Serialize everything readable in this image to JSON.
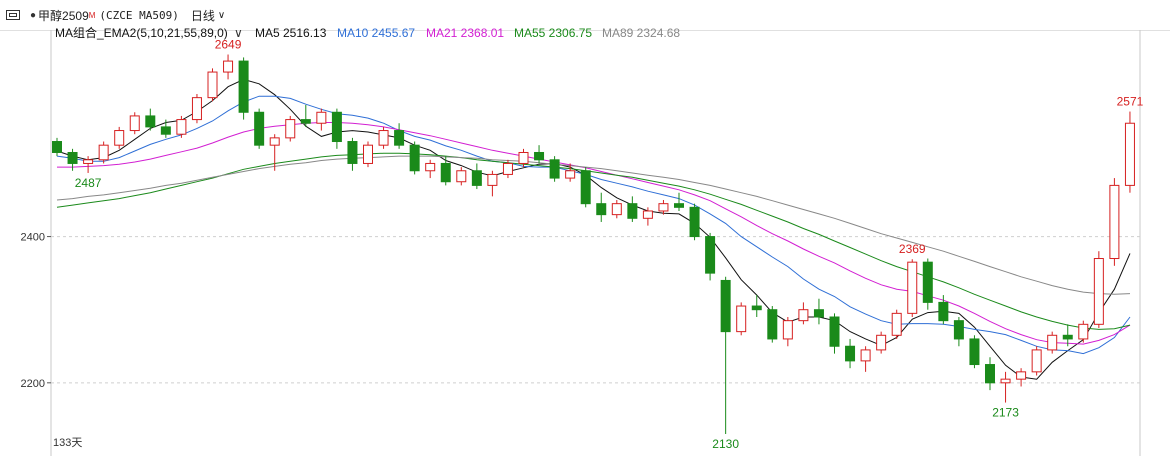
{
  "toolbar": {
    "symbol": "甲醇2509",
    "symbol_sup": "M",
    "code": "(CZCE MA509)",
    "period": "日线"
  },
  "legend": {
    "group": "MA组合_EMA2(5,10,21,55,89,0)",
    "items": [
      {
        "label": "MA5 2516.13",
        "color": "#111111"
      },
      {
        "label": "MA10 2455.67",
        "color": "#2f6fd6"
      },
      {
        "label": "MA21 2368.01",
        "color": "#d21fd2"
      },
      {
        "label": "MA55 2306.75",
        "color": "#1b8a1b"
      },
      {
        "label": "MA89 2324.68",
        "color": "#888888"
      }
    ]
  },
  "days_label": "133天",
  "colors": {
    "up": "#d62020",
    "down": "#1a8a1a",
    "grid": "#cfcfcf"
  },
  "chart_data": {
    "type": "candlestick",
    "ylim": [
      2130,
      2662
    ],
    "yticks": [
      2200,
      2400
    ],
    "annotations": [
      {
        "index": 11,
        "value": 2649,
        "label": "2649",
        "pos": "above",
        "color": "#d62020"
      },
      {
        "index": 2,
        "value": 2487,
        "label": "2487",
        "pos": "below",
        "color": "#1a8a1a"
      },
      {
        "index": 43,
        "value": 2130,
        "label": "2130",
        "pos": "below",
        "color": "#1a8a1a"
      },
      {
        "index": 55,
        "value": 2369,
        "label": "2369",
        "pos": "above",
        "color": "#d62020"
      },
      {
        "index": 61,
        "value": 2173,
        "label": "2173",
        "pos": "below",
        "color": "#1a8a1a"
      },
      {
        "index": 69,
        "value": 2571,
        "label": "2571",
        "pos": "above",
        "color": "#d62020"
      }
    ],
    "candles": [
      [
        2530,
        2535,
        2510,
        2515
      ],
      [
        2515,
        2520,
        2490,
        2500
      ],
      [
        2500,
        2510,
        2487,
        2505
      ],
      [
        2505,
        2530,
        2500,
        2525
      ],
      [
        2525,
        2550,
        2520,
        2545
      ],
      [
        2545,
        2570,
        2540,
        2565
      ],
      [
        2565,
        2575,
        2545,
        2550
      ],
      [
        2550,
        2560,
        2535,
        2540
      ],
      [
        2540,
        2565,
        2535,
        2560
      ],
      [
        2560,
        2595,
        2555,
        2590
      ],
      [
        2590,
        2630,
        2585,
        2625
      ],
      [
        2625,
        2649,
        2615,
        2640
      ],
      [
        2640,
        2645,
        2560,
        2570
      ],
      [
        2570,
        2575,
        2520,
        2525
      ],
      [
        2525,
        2540,
        2490,
        2535
      ],
      [
        2535,
        2565,
        2530,
        2560
      ],
      [
        2560,
        2580,
        2550,
        2555
      ],
      [
        2555,
        2575,
        2545,
        2570
      ],
      [
        2570,
        2575,
        2520,
        2530
      ],
      [
        2530,
        2535,
        2490,
        2500
      ],
      [
        2500,
        2530,
        2495,
        2525
      ],
      [
        2525,
        2550,
        2520,
        2545
      ],
      [
        2545,
        2555,
        2520,
        2525
      ],
      [
        2525,
        2530,
        2485,
        2490
      ],
      [
        2490,
        2505,
        2480,
        2500
      ],
      [
        2500,
        2510,
        2470,
        2475
      ],
      [
        2475,
        2495,
        2470,
        2490
      ],
      [
        2490,
        2500,
        2465,
        2470
      ],
      [
        2470,
        2490,
        2455,
        2485
      ],
      [
        2485,
        2505,
        2480,
        2500
      ],
      [
        2500,
        2520,
        2495,
        2515
      ],
      [
        2515,
        2525,
        2500,
        2505
      ],
      [
        2505,
        2510,
        2475,
        2480
      ],
      [
        2480,
        2500,
        2475,
        2490
      ],
      [
        2490,
        2495,
        2440,
        2445
      ],
      [
        2445,
        2460,
        2420,
        2430
      ],
      [
        2430,
        2450,
        2425,
        2445
      ],
      [
        2445,
        2455,
        2420,
        2425
      ],
      [
        2425,
        2440,
        2415,
        2435
      ],
      [
        2435,
        2450,
        2430,
        2445
      ],
      [
        2445,
        2460,
        2435,
        2440
      ],
      [
        2440,
        2445,
        2395,
        2400
      ],
      [
        2400,
        2405,
        2340,
        2350
      ],
      [
        2340,
        2345,
        2130,
        2270
      ],
      [
        2270,
        2310,
        2265,
        2305
      ],
      [
        2305,
        2320,
        2290,
        2300
      ],
      [
        2300,
        2305,
        2255,
        2260
      ],
      [
        2260,
        2290,
        2250,
        2285
      ],
      [
        2285,
        2310,
        2280,
        2300
      ],
      [
        2300,
        2315,
        2280,
        2290
      ],
      [
        2290,
        2295,
        2240,
        2250
      ],
      [
        2250,
        2260,
        2220,
        2230
      ],
      [
        2230,
        2250,
        2215,
        2245
      ],
      [
        2245,
        2270,
        2240,
        2265
      ],
      [
        2265,
        2300,
        2260,
        2295
      ],
      [
        2295,
        2369,
        2290,
        2365
      ],
      [
        2365,
        2370,
        2300,
        2310
      ],
      [
        2310,
        2320,
        2280,
        2285
      ],
      [
        2285,
        2290,
        2250,
        2260
      ],
      [
        2260,
        2265,
        2220,
        2225
      ],
      [
        2225,
        2235,
        2190,
        2200
      ],
      [
        2200,
        2215,
        2173,
        2205
      ],
      [
        2205,
        2220,
        2195,
        2215
      ],
      [
        2215,
        2250,
        2210,
        2245
      ],
      [
        2245,
        2270,
        2240,
        2265
      ],
      [
        2265,
        2280,
        2250,
        2260
      ],
      [
        2260,
        2285,
        2255,
        2280
      ],
      [
        2280,
        2380,
        2275,
        2370
      ],
      [
        2370,
        2480,
        2360,
        2470
      ],
      [
        2470,
        2571,
        2460,
        2555
      ]
    ],
    "ma": {
      "MA5": [
        2517,
        2510,
        2505,
        2508,
        2518,
        2533,
        2548,
        2556,
        2559,
        2571,
        2586,
        2605,
        2615,
        2609,
        2594,
        2574,
        2551,
        2537,
        2543,
        2545,
        2543,
        2539,
        2535,
        2525,
        2518,
        2504,
        2497,
        2488,
        2483,
        2489,
        2494,
        2499,
        2500,
        2495,
        2484,
        2467,
        2453,
        2443,
        2435,
        2432,
        2431,
        2418,
        2399,
        2371,
        2341,
        2320,
        2296,
        2283,
        2290,
        2290,
        2285,
        2270,
        2260,
        2251,
        2262,
        2287,
        2296,
        2298,
        2295,
        2276,
        2250,
        2224,
        2208,
        2205,
        2228,
        2244,
        2259,
        2296,
        2328,
        2377
      ],
      "MA10": [
        2510,
        2507,
        2503,
        2503,
        2508,
        2517,
        2526,
        2533,
        2539,
        2548,
        2558,
        2572,
        2584,
        2592,
        2592,
        2589,
        2581,
        2574,
        2568,
        2566,
        2562,
        2555,
        2545,
        2537,
        2532,
        2524,
        2518,
        2510,
        2503,
        2501,
        2496,
        2495,
        2495,
        2490,
        2485,
        2478,
        2473,
        2468,
        2462,
        2457,
        2452,
        2443,
        2431,
        2418,
        2400,
        2386,
        2372,
        2359,
        2342,
        2328,
        2318,
        2304,
        2294,
        2285,
        2280,
        2281,
        2281,
        2280,
        2277,
        2273,
        2270,
        2266,
        2258,
        2250,
        2245,
        2244,
        2240,
        2248,
        2262,
        2290
      ],
      "MA21": [
        2495,
        2495,
        2496,
        2497,
        2499,
        2502,
        2506,
        2511,
        2516,
        2521,
        2528,
        2536,
        2543,
        2548,
        2551,
        2553,
        2555,
        2556,
        2556,
        2555,
        2553,
        2550,
        2546,
        2542,
        2538,
        2533,
        2528,
        2523,
        2518,
        2514,
        2510,
        2506,
        2502,
        2498,
        2494,
        2489,
        2484,
        2479,
        2474,
        2469,
        2464,
        2457,
        2449,
        2438,
        2427,
        2415,
        2404,
        2394,
        2383,
        2373,
        2364,
        2353,
        2343,
        2334,
        2328,
        2325,
        2319,
        2313,
        2305,
        2295,
        2284,
        2274,
        2266,
        2259,
        2255,
        2254,
        2253,
        2258,
        2266,
        2279
      ],
      "MA55": [
        2440,
        2443,
        2446,
        2449,
        2452,
        2456,
        2460,
        2465,
        2470,
        2475,
        2480,
        2486,
        2492,
        2496,
        2500,
        2503,
        2506,
        2509,
        2511,
        2512,
        2513,
        2514,
        2514,
        2513,
        2512,
        2510,
        2508,
        2505,
        2503,
        2501,
        2499,
        2497,
        2495,
        2493,
        2490,
        2487,
        2484,
        2481,
        2477,
        2473,
        2469,
        2464,
        2458,
        2451,
        2444,
        2436,
        2428,
        2420,
        2411,
        2403,
        2394,
        2385,
        2376,
        2367,
        2359,
        2352,
        2345,
        2338,
        2330,
        2321,
        2313,
        2305,
        2297,
        2290,
        2284,
        2279,
        2275,
        2273,
        2274,
        2279
      ],
      "MA89": [
        2450,
        2452,
        2455,
        2457,
        2460,
        2463,
        2466,
        2470,
        2473,
        2477,
        2481,
        2485,
        2489,
        2493,
        2496,
        2499,
        2501,
        2504,
        2506,
        2507,
        2508,
        2509,
        2510,
        2510,
        2510,
        2509,
        2508,
        2507,
        2505,
        2504,
        2503,
        2501,
        2499,
        2497,
        2495,
        2493,
        2490,
        2487,
        2484,
        2481,
        2478,
        2474,
        2470,
        2465,
        2460,
        2455,
        2449,
        2443,
        2437,
        2431,
        2425,
        2418,
        2411,
        2404,
        2398,
        2392,
        2386,
        2380,
        2373,
        2366,
        2359,
        2352,
        2345,
        2339,
        2333,
        2328,
        2324,
        2322,
        2321,
        2322
      ]
    }
  }
}
